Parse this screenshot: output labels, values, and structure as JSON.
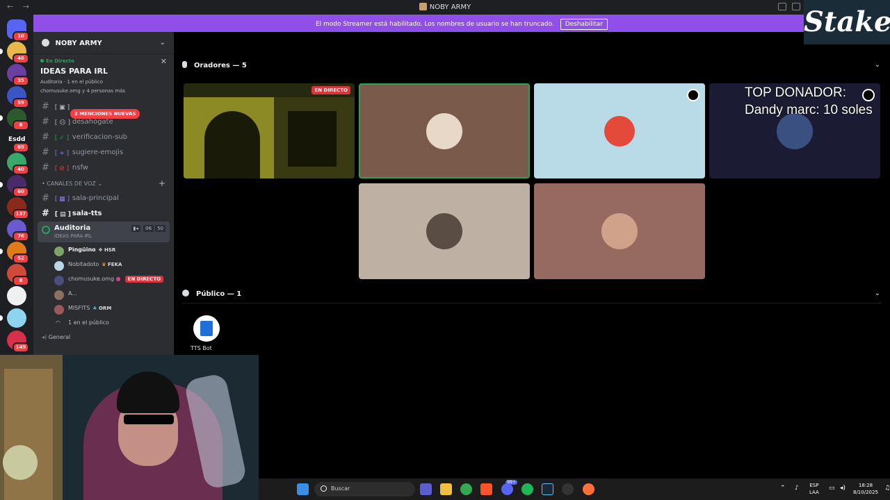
{
  "window": {
    "title": "NOBY ARMY",
    "back": "←",
    "forward": "→"
  },
  "banner": {
    "text": "El modo Streamer está habilitado. Los nombres de usuario se han truncado.",
    "button": "Deshabilitar"
  },
  "brand_overlay": {
    "text": "Stake"
  },
  "servers": [
    {
      "icon": "discord-home-icon",
      "badge": "10"
    },
    {
      "icon": "server-icon",
      "badge": "46"
    },
    {
      "icon": "server-icon",
      "badge": "35"
    },
    {
      "icon": "server-icon",
      "badge": "59"
    },
    {
      "icon": "server-icon",
      "badge": "8"
    },
    {
      "icon": "server-icon",
      "badge": "69",
      "label": "Esdd"
    },
    {
      "icon": "server-icon",
      "badge": "40"
    },
    {
      "icon": "server-icon",
      "badge": "60"
    },
    {
      "icon": "server-icon",
      "badge": "137"
    },
    {
      "icon": "server-icon",
      "badge": "76"
    },
    {
      "icon": "server-icon",
      "badge": "52"
    },
    {
      "icon": "server-icon",
      "badge": "8"
    },
    {
      "icon": "server-icon",
      "badge": ""
    },
    {
      "icon": "server-icon",
      "badge": ""
    },
    {
      "icon": "server-icon",
      "badge": "149"
    }
  ],
  "sidebar": {
    "server_name": "NOBY ARMY",
    "live_card": {
      "status": "En Directo",
      "title": "IDEAS PARA IRL",
      "channel": "Auditoria",
      "audience": "1 en el público",
      "viewers": "chomusuke.omg y 4 personas más"
    },
    "mentions_badge": "2 MENCIONES NUEVAS",
    "channels": [
      {
        "name": ""
      },
      {
        "name": "desahógate"
      },
      {
        "name": "verificacion-sub"
      },
      {
        "name": "sugiere-emojis"
      },
      {
        "name": "nsfw"
      }
    ],
    "voice_category": "• CANALES DE VOZ",
    "voice_text_channels": [
      {
        "name": "sala-principal"
      },
      {
        "name": "sala-tts"
      }
    ],
    "active_voice": {
      "name": "Auditoria",
      "subtitle": "IDEAS PARA IRL",
      "count_a": "06",
      "count_b": "50"
    },
    "members": [
      {
        "name": "Pingüino",
        "tag": "HSR"
      },
      {
        "name": "Nobitadoto",
        "tag": "FEKA"
      },
      {
        "name": "chomusuke.omg",
        "live": "EN DIRECTO"
      },
      {
        "name": "A..."
      },
      {
        "name": "MISFITS",
        "tag": "ORM"
      }
    ],
    "audience_count": "1 en el público",
    "next_channel": "General"
  },
  "main": {
    "speakers_header": "Oradores — 5",
    "stream_live": "EN DIRECTO",
    "audience_header": "Público — 1",
    "bot_name": "TTS Bot"
  },
  "overlay": {
    "line1": "TOP DONADOR:",
    "line2": "Dandy marc: 10 soles"
  },
  "taskbar": {
    "search_placeholder": "Buscar",
    "lang_top": "ESP",
    "lang_bottom": "LAA",
    "time": "18:28",
    "date": "8/10/2025",
    "discord_badge": "99+"
  },
  "colors": {
    "accent": "#8f4fe8",
    "live": "#da373c",
    "online": "#23a55a"
  }
}
